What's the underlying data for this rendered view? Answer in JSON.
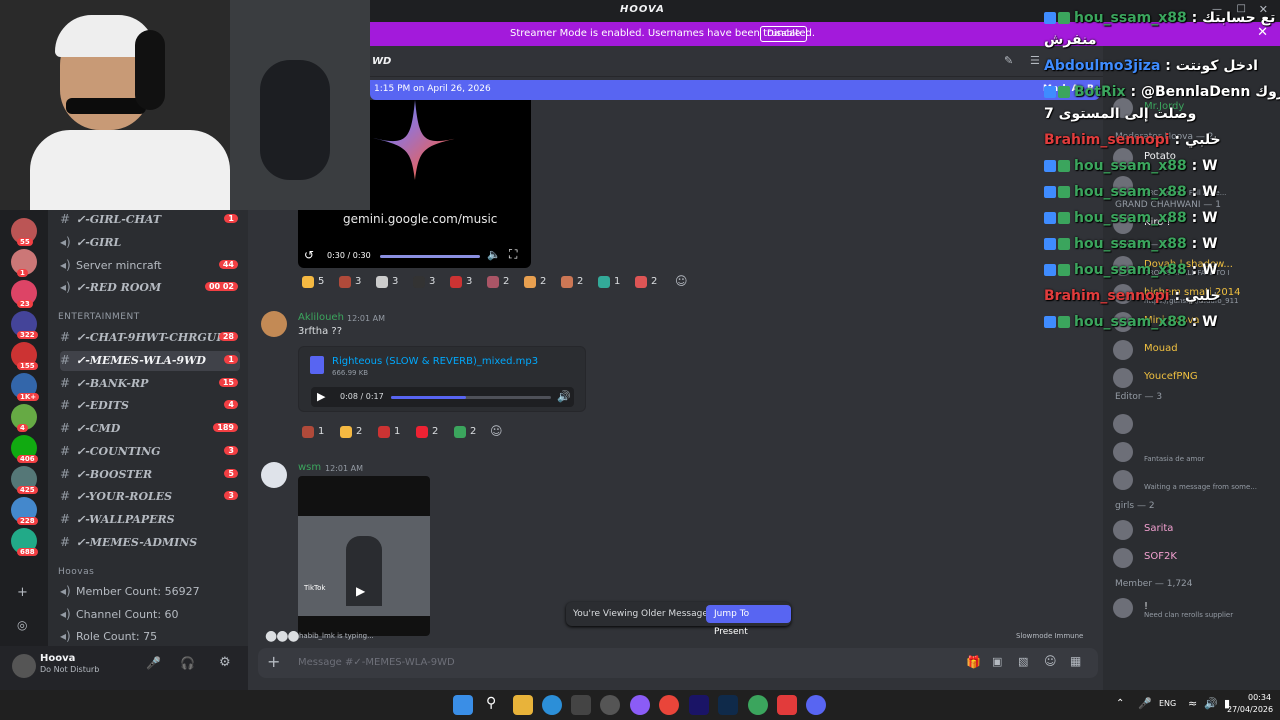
{
  "app": {
    "title": "HOOVA"
  },
  "banner": {
    "text": "Streamer Mode is enabled. Usernames have been truncated.",
    "disable_label": "Disable"
  },
  "channel_header": {
    "name": "WD"
  },
  "new_messages": {
    "since": "1:15 PM on April 26, 2026",
    "mark_read": "Mark As R"
  },
  "servers": [
    {
      "badge": "55"
    },
    {
      "badge": "1"
    },
    {
      "badge": "23"
    },
    {
      "badge": "322"
    },
    {
      "badge": "155"
    },
    {
      "badge": "1K+"
    },
    {
      "badge": "4"
    },
    {
      "badge": "406"
    },
    {
      "badge": "425"
    },
    {
      "badge": "228"
    },
    {
      "badge": "688"
    }
  ],
  "channels": [
    {
      "name": "✓-GIRL-CHAT",
      "count": "1"
    },
    {
      "name": "✓-GIRL",
      "count": ""
    },
    {
      "name": "Server mincraft",
      "count": "44"
    },
    {
      "name": "✓-RED ROOM",
      "count": "00  02"
    },
    {
      "name": "✓-CHAT-9HWT-CHRGUI",
      "count": "28"
    },
    {
      "name": "✓-MEMES-WLA-9WD",
      "count": "1"
    },
    {
      "name": "✓-BANK-RP",
      "count": "15"
    },
    {
      "name": "✓-EDITS",
      "count": "4"
    },
    {
      "name": "✓-CMD",
      "count": "189"
    },
    {
      "name": "✓-COUNTING",
      "count": "3"
    },
    {
      "name": "✓-BOOSTER",
      "count": "5"
    },
    {
      "name": "✓-YOUR-ROLES",
      "count": "3"
    },
    {
      "name": "✓-WALLPAPERS",
      "count": ""
    },
    {
      "name": "✓-MEMES-ADMINS",
      "count": ""
    }
  ],
  "categories": {
    "entertainment": "ENTERTAINMENT",
    "hoovas": "Hoovas"
  },
  "stats": [
    "Member Count: 56927",
    "Channel Count: 60",
    "Role Count: 75"
  ],
  "user": {
    "name": "Hoova",
    "status": "Do Not Disturb"
  },
  "video_embed": {
    "url": "gemini.google.com/music",
    "time": "0:30 / 0:30"
  },
  "reactions_1": [
    "5",
    "3",
    "3",
    "3",
    "3",
    "2",
    "2",
    "2",
    "1",
    "2"
  ],
  "message_1": {
    "author": "Akliloueh",
    "time": "12:01 AM",
    "text": "3rftha ??"
  },
  "attachment": {
    "filename": "Righteous (SLOW & REVERB)_mixed.mp3",
    "size": "666.99 KB",
    "time": "0:08 / 0:17",
    "progress": 0.47
  },
  "reactions_2": [
    "1",
    "2",
    "1",
    "2",
    "2"
  ],
  "message_2": {
    "author": "wsm",
    "time": "12:01 AM",
    "tiktok": "TikTok"
  },
  "typing": "habib_lmk is typing...",
  "older": {
    "text": "You're Viewing Older Messages",
    "jump": "Jump To Present"
  },
  "slowmode": "Slowmode Immune",
  "composer": {
    "placeholder": "Message #✓-MEMES-WLA-9WD"
  },
  "members": {
    "top": [
      {
        "name": "Mr.Jordy",
        "sub": ""
      }
    ],
    "cat_moderator": "Moderator Hoova — 2",
    "moderators": [
      {
        "name": "Potato",
        "sub": ""
      },
      {
        "name": "",
        "sub": "ARC Raiders Full Acce..."
      }
    ],
    "cat_grand": "GRAND CHAHWANI — 1",
    "grand": [
      {
        "name": "Kiro !",
        "sub": ""
      }
    ],
    "cat_memer": "Memer — 5",
    "memers": [
      {
        "name": "Dovah | shadow...",
        "sub": "CROWS SHALL FALL TO I"
      },
      {
        "name": "hichem smati 2014",
        "sub": "https://guns.lol/tuuufo_911"
      },
      {
        "name": "Mini Hoova",
        "sub": ""
      },
      {
        "name": "Mouad",
        "sub": ""
      },
      {
        "name": "YoucefPNG",
        "sub": ""
      }
    ],
    "cat_editor": "Editor — 3",
    "editors": [
      {
        "name": "",
        "sub": ""
      },
      {
        "name": "",
        "sub": "Fantasia de amor"
      },
      {
        "name": "",
        "sub": "Waiting a message from some..."
      }
    ],
    "cat_girls": "girls — 2",
    "girls": [
      {
        "name": "Sarita",
        "sub": ""
      },
      {
        "name": "SOF2K",
        "sub": ""
      }
    ],
    "cat_member": "Member — 1,724",
    "member": [
      {
        "name": "!",
        "sub": "Need clan rerolls supplier"
      }
    ]
  },
  "overlay_chat": [
    {
      "user": "hou_ssam_x88",
      "msg": "هلاك تع حسابتك"
    },
    {
      "user": "",
      "msg": "منفرش"
    },
    {
      "user": "Abdoulmo3jiza",
      "msg": "ادخل كونتت"
    },
    {
      "user": "BotRix",
      "msg": "@BennlaDenn مبروك!"
    },
    {
      "user": "",
      "msg": "وصلت إلى المستوى 7"
    },
    {
      "user": "Brahim_sennopi",
      "msg": "خلبي"
    },
    {
      "user": "hou_ssam_x88",
      "msg": "W"
    },
    {
      "user": "hou_ssam_x88",
      "msg": "W"
    },
    {
      "user": "hou_ssam_x88",
      "msg": "W"
    },
    {
      "user": "hou_ssam_x88",
      "msg": "W"
    },
    {
      "user": "hou_ssam_x88",
      "msg": "W"
    },
    {
      "user": "Brahim_sennopi",
      "msg": "خلبي"
    },
    {
      "user": "hou_ssam_x88",
      "msg": "W"
    }
  ],
  "taskbar": {
    "lang": "ENG",
    "time": "00:34",
    "date": "27/04/2026"
  },
  "colors": {
    "accent": "#5865f2",
    "banner": "#a31adb",
    "online": "#3ba55d",
    "danger": "#f23f43"
  }
}
